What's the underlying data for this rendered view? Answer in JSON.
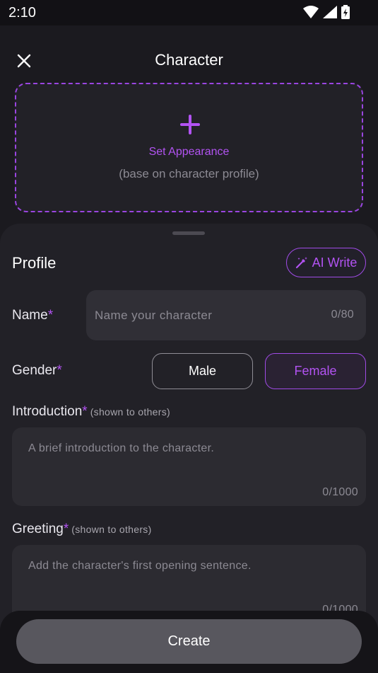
{
  "status_bar": {
    "time": "2:10"
  },
  "header": {
    "title": "Character"
  },
  "appearance": {
    "label": "Set Appearance",
    "hint": "(base on character profile)"
  },
  "profile": {
    "title": "Profile",
    "ai_write_label": "AI Write",
    "name": {
      "label": "Name",
      "required_mark": "*",
      "placeholder": "Name your character",
      "counter": "0/80"
    },
    "gender": {
      "label": "Gender",
      "required_mark": "*",
      "options": [
        "Male",
        "Female"
      ],
      "selected": "Female"
    },
    "introduction": {
      "label": "Introduction",
      "required_mark": "*",
      "note": "(shown to others)",
      "placeholder": "A brief introduction to the character.",
      "counter": "0/1000"
    },
    "greeting": {
      "label": "Greeting",
      "required_mark": "*",
      "note": "(shown to others)",
      "placeholder": "Add the character's first opening sentence.",
      "counter": "0/1000"
    }
  },
  "footer": {
    "create_label": "Create"
  },
  "colors": {
    "accent": "#b253f2",
    "background": "#1b1a1f",
    "sheet": "#222127",
    "input": "#302f36"
  }
}
